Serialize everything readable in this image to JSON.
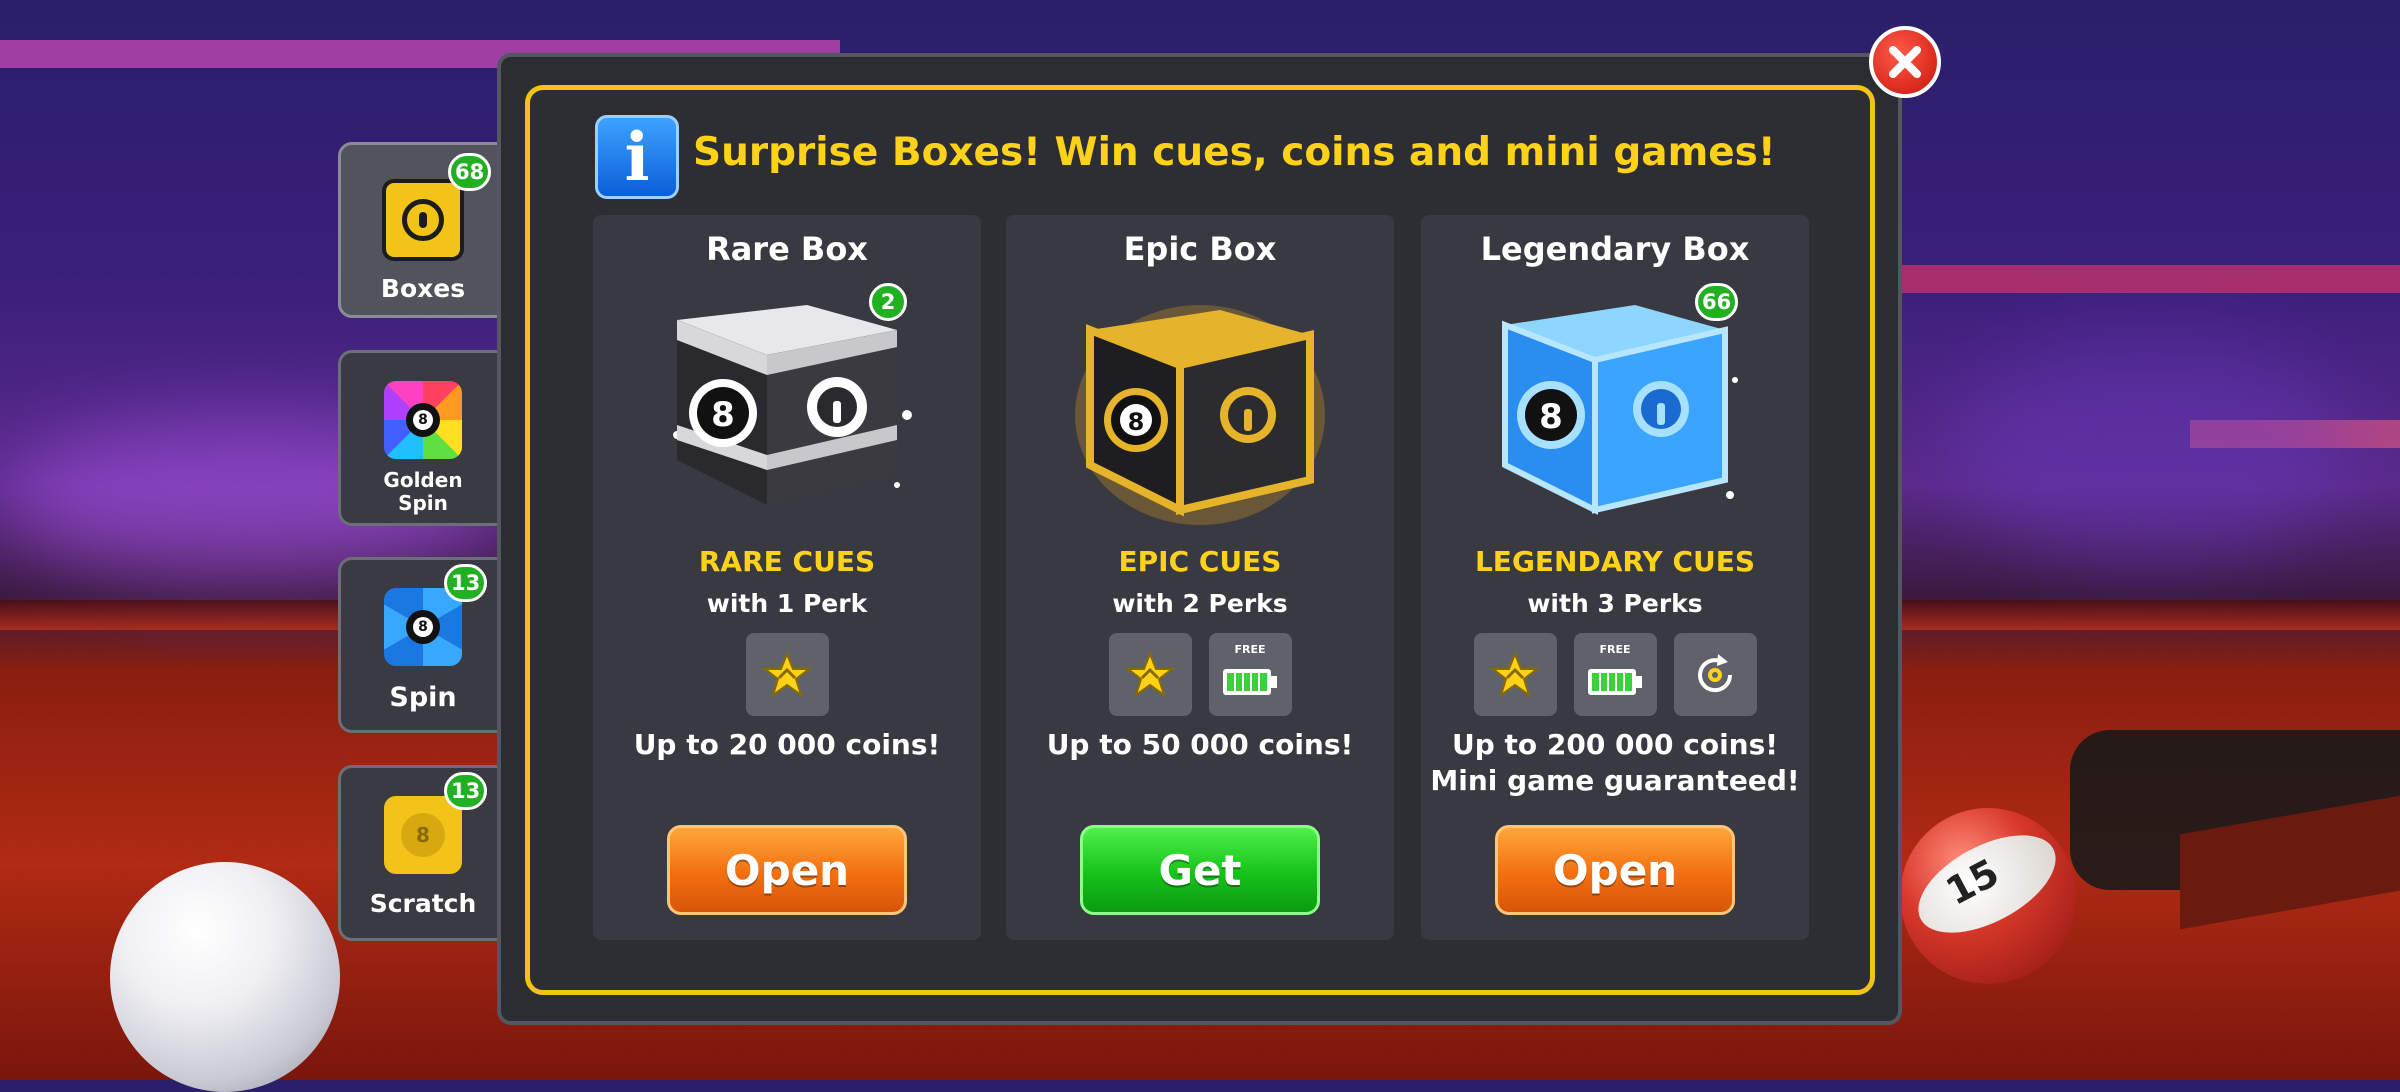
{
  "side_tabs": [
    {
      "label": "Boxes",
      "badge": "68"
    },
    {
      "label": "Golden Spin",
      "badge": ""
    },
    {
      "label": "Spin",
      "badge": "13"
    },
    {
      "label": "Scratch",
      "badge": "13"
    }
  ],
  "tab_icon_ball": "8",
  "panel": {
    "info_glyph": "i",
    "title": "Surprise Boxes! Win cues, coins and mini games!"
  },
  "boxes": [
    {
      "name": "Rare Box",
      "badge": "2",
      "cue_type": "RARE CUES",
      "perks_text": "with 1 Perk",
      "coins_line1": "Up to 20 000  coins!",
      "coins_line2": "",
      "button": "Open"
    },
    {
      "name": "Epic Box",
      "badge": "",
      "cue_type": "EPIC CUES",
      "perks_text": "with 2 Perks",
      "coins_line1": "Up to 50 000 coins!",
      "coins_line2": "",
      "button": "Get"
    },
    {
      "name": "Legendary Box",
      "badge": "66",
      "cue_type": "LEGENDARY CUES",
      "perks_text": "with 3 Perks",
      "coins_line1": "Up to 200 000 coins!",
      "coins_line2": "Mini game guaranteed!",
      "button": "Open"
    }
  ],
  "perk_free_label": "FREE",
  "box_ball_number": "8",
  "ball15_number": "15",
  "colors": {
    "accent_yellow": "#ffd21a",
    "panel_border": "#f3c417",
    "badge_green": "#21b021",
    "button_orange": "#f26f10",
    "button_green": "#16c21a",
    "close_red": "#c8140a"
  }
}
